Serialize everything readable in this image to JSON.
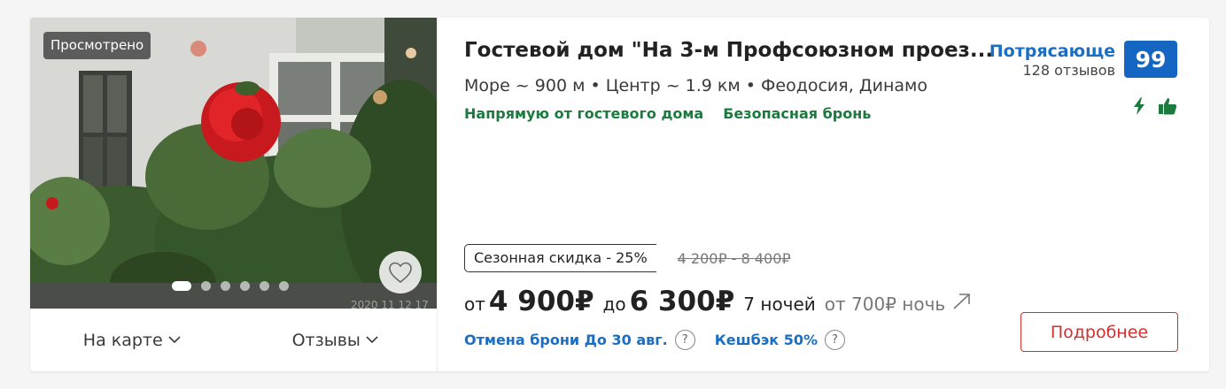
{
  "photo": {
    "viewed_badge": "Просмотрено",
    "date_watermark": "2020 11 12 17",
    "dot_count": 6,
    "active_dot": 0
  },
  "links": {
    "map": "На карте",
    "reviews": "Отзывы"
  },
  "hotel": {
    "title": "Гостевой дом \"На 3-м Профсоюзном проез...",
    "location": "Море ~ 900 м  •  Центр ~ 1.9 км  •  Феодосия, Динамо",
    "tag_direct": "Напрямую от гостевого дома",
    "tag_safe": "Безопасная бронь"
  },
  "rating": {
    "label": "Потрясающе",
    "reviews": "128 отзывов",
    "score": "99"
  },
  "pricing": {
    "discount_label": "Сезонная скидка - 25%",
    "old_price": "4 200₽ - 8 400₽",
    "from_label": "от",
    "min_price": "4 900₽",
    "to_label": "до",
    "max_price": "6 300₽",
    "nights": "7 ночей",
    "per_night": "от 700₽ ночь"
  },
  "info": {
    "cancel": "Отмена брони До 30 авг.",
    "cashback": "Кешбэк 50%",
    "q_mark": "?"
  },
  "actions": {
    "more_button": "Подробнее"
  },
  "colors": {
    "accent_blue": "#1466c2",
    "green": "#1c7a3e",
    "red": "#d32f2f"
  }
}
